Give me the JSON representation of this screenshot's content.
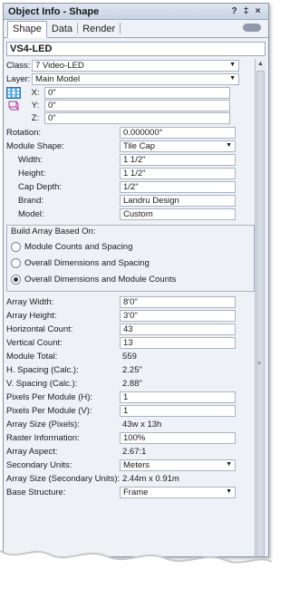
{
  "window": {
    "title": "Object Info - Shape",
    "btn_help": "?",
    "btn_pin": "‡",
    "btn_close": "×"
  },
  "tabs": [
    "Shape",
    "Data",
    "Render"
  ],
  "object_name": "VS4-LED",
  "fields": {
    "class": {
      "label": "Class:",
      "value": "7 Video-LED"
    },
    "layer": {
      "label": "Layer:",
      "value": "Main Model"
    },
    "x": {
      "label": "X:",
      "value": "0\""
    },
    "y": {
      "label": "Y:",
      "value": "0\""
    },
    "z": {
      "label": "Z:",
      "value": "0\""
    },
    "rotation": {
      "label": "Rotation:",
      "value": "0.000000°"
    },
    "module_shape": {
      "label": "Module Shape:",
      "value": "Tile Cap"
    },
    "width": {
      "label": "Width:",
      "value": "1 1/2\""
    },
    "height": {
      "label": "Height:",
      "value": "1 1/2\""
    },
    "cap_depth": {
      "label": "Cap Depth:",
      "value": "1/2\""
    },
    "brand": {
      "label": "Brand:",
      "value": "Landru Design"
    },
    "model": {
      "label": "Model:",
      "value": "Custom"
    }
  },
  "build_array": {
    "title": "Build Array Based On:",
    "options": [
      "Module Counts and Spacing",
      "Overall Dimensions and Spacing",
      "Overall Dimensions and Module Counts"
    ],
    "selected_index": 2
  },
  "array": {
    "array_width": {
      "label": "Array Width:",
      "value": "8'0\""
    },
    "array_height": {
      "label": "Array Height:",
      "value": "3'0\""
    },
    "horizontal_count": {
      "label": "Horizontal Count:",
      "value": "43"
    },
    "vertical_count": {
      "label": "Vertical Count:",
      "value": "13"
    },
    "module_total": {
      "label": "Module Total:",
      "value": "559"
    },
    "h_spacing": {
      "label": "H. Spacing (Calc.):",
      "value": "2.25\""
    },
    "v_spacing": {
      "label": "V. Spacing (Calc.):",
      "value": "2.88\""
    },
    "pixels_h": {
      "label": "Pixels Per Module (H):",
      "value": "1"
    },
    "pixels_v": {
      "label": "Pixels Per Module (V):",
      "value": "1"
    },
    "array_size_px": {
      "label": "Array Size (Pixels):",
      "value": "43w x 13h"
    },
    "raster_info": {
      "label": "Raster Information:",
      "value": "100%"
    },
    "array_aspect": {
      "label": "Array Aspect:",
      "value": "2.67:1"
    },
    "secondary_units": {
      "label": "Secondary Units:",
      "value": "Meters"
    },
    "array_size_secondary": {
      "label": "Array Size (Secondary Units):",
      "value": "2.44m x 0.91m"
    },
    "base_structure": {
      "label": "Base Structure:",
      "value": "Frame"
    }
  }
}
